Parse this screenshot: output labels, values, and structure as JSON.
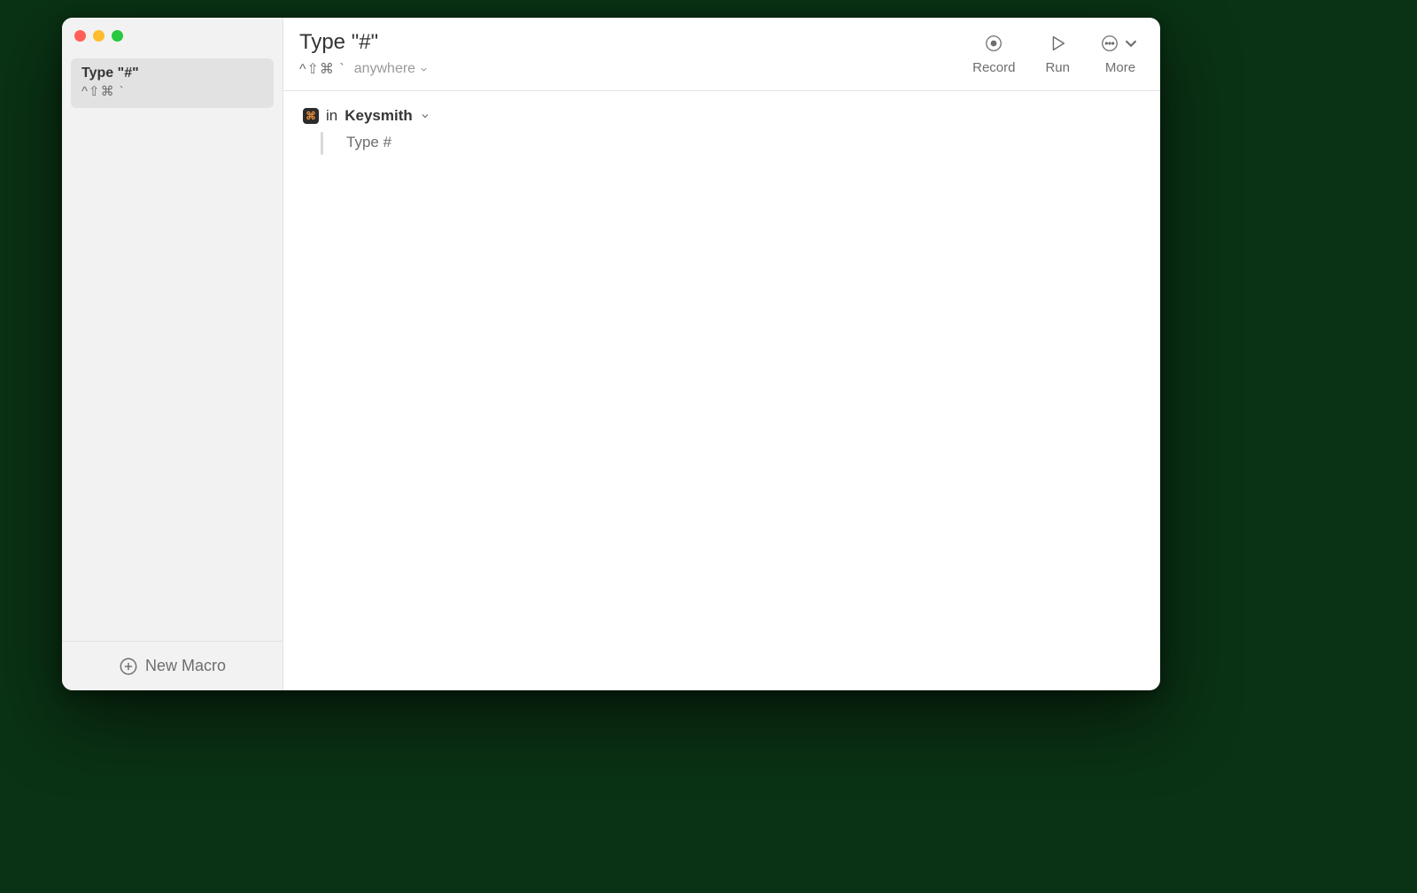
{
  "sidebar": {
    "items": [
      {
        "title": "Type \"#\"",
        "shortcut": "^⇧⌘ `"
      }
    ],
    "new_macro_label": "New Macro"
  },
  "header": {
    "title": "Type \"#\"",
    "shortcut": "^⇧⌘ `",
    "scope": "anywhere"
  },
  "toolbar": {
    "record": "Record",
    "run": "Run",
    "more": "More"
  },
  "context": {
    "in": "in",
    "app": "Keysmith",
    "app_icon_glyph": "⌘"
  },
  "steps": [
    {
      "text": "Type #"
    }
  ]
}
